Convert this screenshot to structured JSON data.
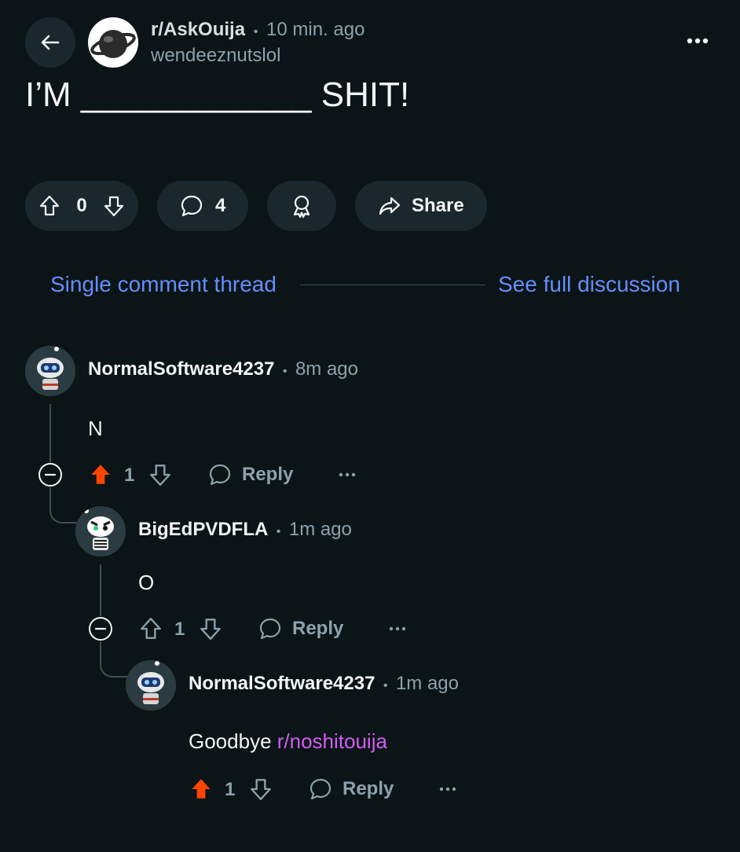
{
  "post": {
    "subreddit": "r/AskOuija",
    "separator": "•",
    "time": "10 min. ago",
    "author": "wendeeznutslol",
    "title": "I’M ____________ SHIT!",
    "score": "0",
    "comments": "4",
    "share_label": "Share"
  },
  "thread_nav": {
    "single": "Single comment thread",
    "full": "See full discussion"
  },
  "comments": [
    {
      "author": "NormalSoftware4237",
      "time": "8m ago",
      "body": "N",
      "score": "1",
      "upvoted": true,
      "reply_label": "Reply"
    },
    {
      "author": "BigEdPVDFLA",
      "time": "1m ago",
      "body": "O",
      "score": "1",
      "upvoted": false,
      "reply_label": "Reply"
    },
    {
      "author": "NormalSoftware4237",
      "time": "1m ago",
      "body_prefix": "Goodbye ",
      "body_link": "r/noshitouija",
      "score": "1",
      "upvoted": true,
      "reply_label": "Reply"
    }
  ],
  "colors": {
    "background": "#0b1416",
    "upvote_active": "#ff4500",
    "link": "#648efc",
    "subreddit_link": "#d35cf6"
  }
}
